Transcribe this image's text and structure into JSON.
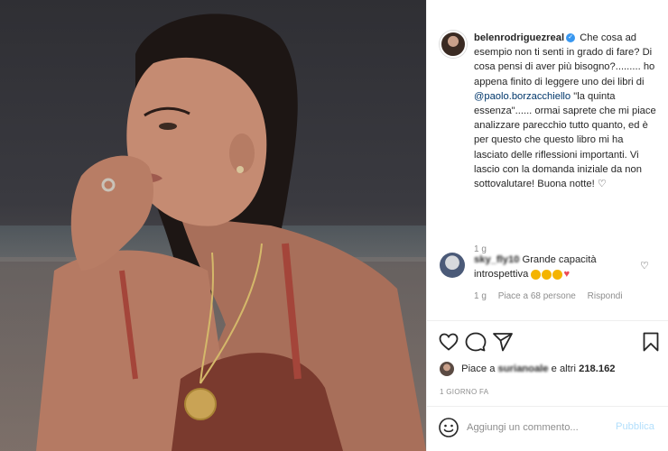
{
  "post": {
    "username": "belenrodriguezreal",
    "caption_lines": [
      "Che cosa ad",
      "esempio non ti senti in grado di fare?",
      "Di cosa pensi di aver più bisogno?.........",
      "ho appena finito di leggere uno dei",
      "libri di",
      "@paolo.borzacchiello",
      "\"la quinta",
      "essenza\"...... ormai saprete che mi",
      "piace analizzare parecchio tutto",
      "quanto, ed è per questo che questo",
      "libro mi ha lasciato delle riflessioni",
      "importanti. Vi lascio con la domanda",
      "iniziale da non sottovalutare! Buona",
      "notte! ♡"
    ],
    "time": "1 g"
  },
  "comment": {
    "username": "sky_fly10",
    "text_before": "Grande capacità",
    "text_after": "introspettiva",
    "time": "1 g",
    "likes": "Piace a 68 persone",
    "reply": "Rispondi"
  },
  "likes": {
    "prefix": "Piace a",
    "user": "surianoale",
    "suffix": "e altri",
    "count": "218.162"
  },
  "date": "1 GIORNO FA",
  "add_comment": {
    "placeholder": "Aggiungi un commento...",
    "publish": "Pubblica"
  },
  "icons": {
    "like": "heart-icon",
    "comment": "comment-icon",
    "share": "share-icon",
    "save": "bookmark-icon",
    "emoji": "emoji-icon"
  },
  "colors": {
    "mention": "#00376b",
    "verified": "#3897f0",
    "publish_disabled": "#b2dffc",
    "secondary_text": "#8e8e8e"
  }
}
